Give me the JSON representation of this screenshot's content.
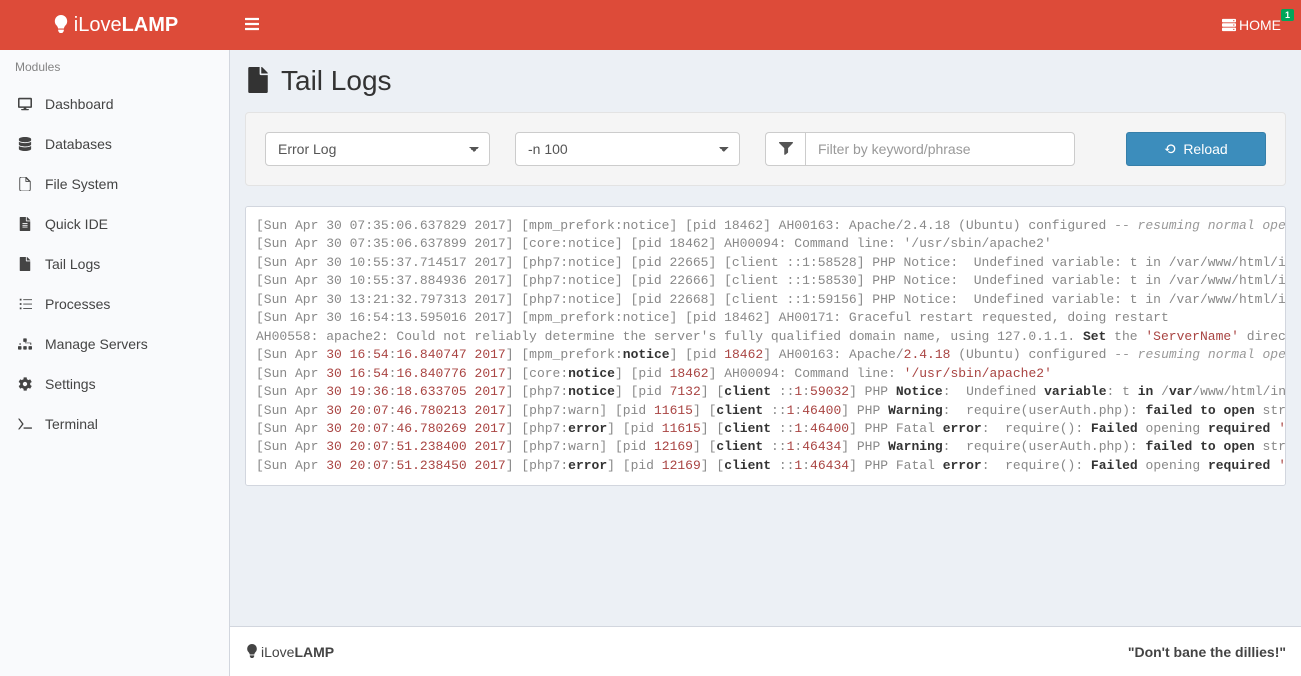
{
  "brand": {
    "pre": "iLove",
    "bold": "LAMP"
  },
  "nav": {
    "home": "HOME",
    "badge": "1"
  },
  "sidebar": {
    "header": "Modules",
    "items": [
      {
        "label": "Dashboard"
      },
      {
        "label": "Databases"
      },
      {
        "label": "File System"
      },
      {
        "label": "Quick IDE"
      },
      {
        "label": "Tail Logs"
      },
      {
        "label": "Processes"
      },
      {
        "label": "Manage Servers"
      },
      {
        "label": "Settings"
      },
      {
        "label": "Terminal"
      }
    ]
  },
  "page": {
    "title": "Tail Logs"
  },
  "controls": {
    "log_select": "Error Log",
    "lines_select": "-n 100",
    "filter_placeholder": "Filter by keyword/phrase",
    "reload": "Reload"
  },
  "log_lines": [
    {
      "html": "[Sun Apr 30 07:35:06.637829 2017] [mpm_prefork:notice] [pid 18462] AH00163: Apache/2.4.18 (Ubuntu) configured <span class='comment'>-- resuming normal operations</span>"
    },
    {
      "html": "[Sun Apr 30 07:35:06.637899 2017] [core:notice] [pid 18462] AH00094: Command line: '/usr/sbin/apache2'"
    },
    {
      "html": "[Sun Apr 30 10:55:37.714517 2017] [php7:notice] [pid 22665] [client ::1:58528] PHP Notice:  Undefined variable: t in /var/www/html/index.php"
    },
    {
      "html": "[Sun Apr 30 10:55:37.884936 2017] [php7:notice] [pid 22666] [client ::1:58530] PHP Notice:  Undefined variable: t in /var/www/html/index.php"
    },
    {
      "html": "[Sun Apr 30 13:21:32.797313 2017] [php7:notice] [pid 22668] [client ::1:59156] PHP Notice:  Undefined variable: t in /var/www/html/index.php"
    },
    {
      "html": "[Sun Apr 30 16:54:13.595016 2017] [mpm_prefork:notice] [pid 18462] AH00171: Graceful restart requested, doing restart"
    },
    {
      "html": "AH00558: apache2: Could not reliably determine the server's fully qualified domain name, using 127.0.1.1. <b>Set</b> the <span class='red'>'ServerName'</span> directive"
    },
    {
      "html": "[Sun Apr <span class='red'>30</span> <span class='red'>16</span>:<span class='red'>54</span>:<span class='red'>16.840747</span> <span class='red'>2017</span>] [mpm_prefork:<b>notice</b>] [pid <span class='red'>18462</span>] AH00163: Apache/<span class='red'>2.4.18</span> (Ubuntu) configured <span class='comment'>-- resuming normal operations</span>"
    },
    {
      "html": "[Sun Apr <span class='red'>30</span> <span class='red'>16</span>:<span class='red'>54</span>:<span class='red'>16.840776</span> <span class='red'>2017</span>] [core:<b>notice</b>] [pid <span class='red'>18462</span>] AH00094: Command line: <span class='red'>'/usr/sbin/apache2'</span>"
    },
    {
      "html": "[Sun Apr <span class='red'>30</span> <span class='red'>19</span>:<span class='red'>36</span>:<span class='red'>18.633705</span> <span class='red'>2017</span>] [php7:<b>notice</b>] [pid <span class='red'>7132</span>] [<b>client</b> ::<span class='red'>1</span>:<span class='red'>59032</span>] PHP <b>Notice</b>:  Undefined <b>variable</b>: t <b>in</b> /<b>var</b>/www/html/index.php"
    },
    {
      "html": "[Sun Apr <span class='red'>30</span> <span class='red'>20</span>:<span class='red'>07</span>:<span class='red'>46.780213</span> <span class='red'>2017</span>] [php7:warn] [pid <span class='red'>11615</span>] [<b>client</b> ::<span class='red'>1</span>:<span class='red'>46400</span>] PHP <b>Warning</b>:  require(userAuth.php): <b>failed to open</b> stream"
    },
    {
      "html": "[Sun Apr <span class='red'>30</span> <span class='red'>20</span>:<span class='red'>07</span>:<span class='red'>46.780269</span> <span class='red'>2017</span>] [php7:<b>error</b>] [pid <span class='red'>11615</span>] [<b>client</b> ::<span class='red'>1</span>:<span class='red'>46400</span>] PHP Fatal <b>error</b>:  require(): <b>Failed</b> opening <b>required</b> <span class='red'>'userAuth.php'</span>"
    },
    {
      "html": "[Sun Apr <span class='red'>30</span> <span class='red'>20</span>:<span class='red'>07</span>:<span class='red'>51.238400</span> <span class='red'>2017</span>] [php7:warn] [pid <span class='red'>12169</span>] [<b>client</b> ::<span class='red'>1</span>:<span class='red'>46434</span>] PHP <b>Warning</b>:  require(userAuth.php): <b>failed to open</b> stream"
    },
    {
      "html": "[Sun Apr <span class='red'>30</span> <span class='red'>20</span>:<span class='red'>07</span>:<span class='red'>51.238450</span> <span class='red'>2017</span>] [php7:<b>error</b>] [pid <span class='red'>12169</span>] [<b>client</b> ::<span class='red'>1</span>:<span class='red'>46434</span>] PHP Fatal <b>error</b>:  require(): <b>Failed</b> opening <b>required</b> <span class='red'>'userAuth.php'</span>"
    }
  ],
  "footer": {
    "brand_pre": "iLove",
    "brand_bold": "LAMP",
    "quote": "\"Don't bane the dillies!\""
  }
}
